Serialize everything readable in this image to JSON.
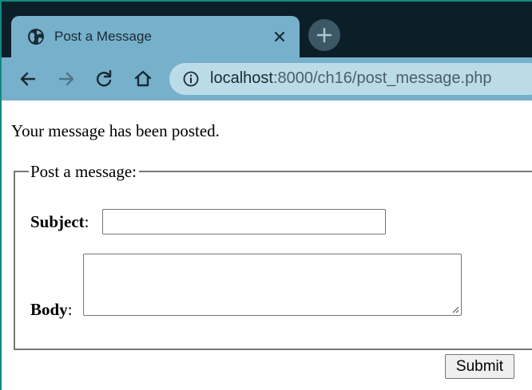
{
  "browser": {
    "tab": {
      "title": "Post a Message"
    },
    "address_bar": {
      "host": "localhost",
      "path": ":8000/ch16/post_message.php"
    }
  },
  "page": {
    "status_message": "Your message has been posted.",
    "form": {
      "legend": "Post a message:",
      "subject_label": "Subject",
      "body_label": "Body",
      "label_suffix": ":",
      "subject_value": "",
      "body_value": "",
      "submit_label": "Submit"
    }
  }
}
